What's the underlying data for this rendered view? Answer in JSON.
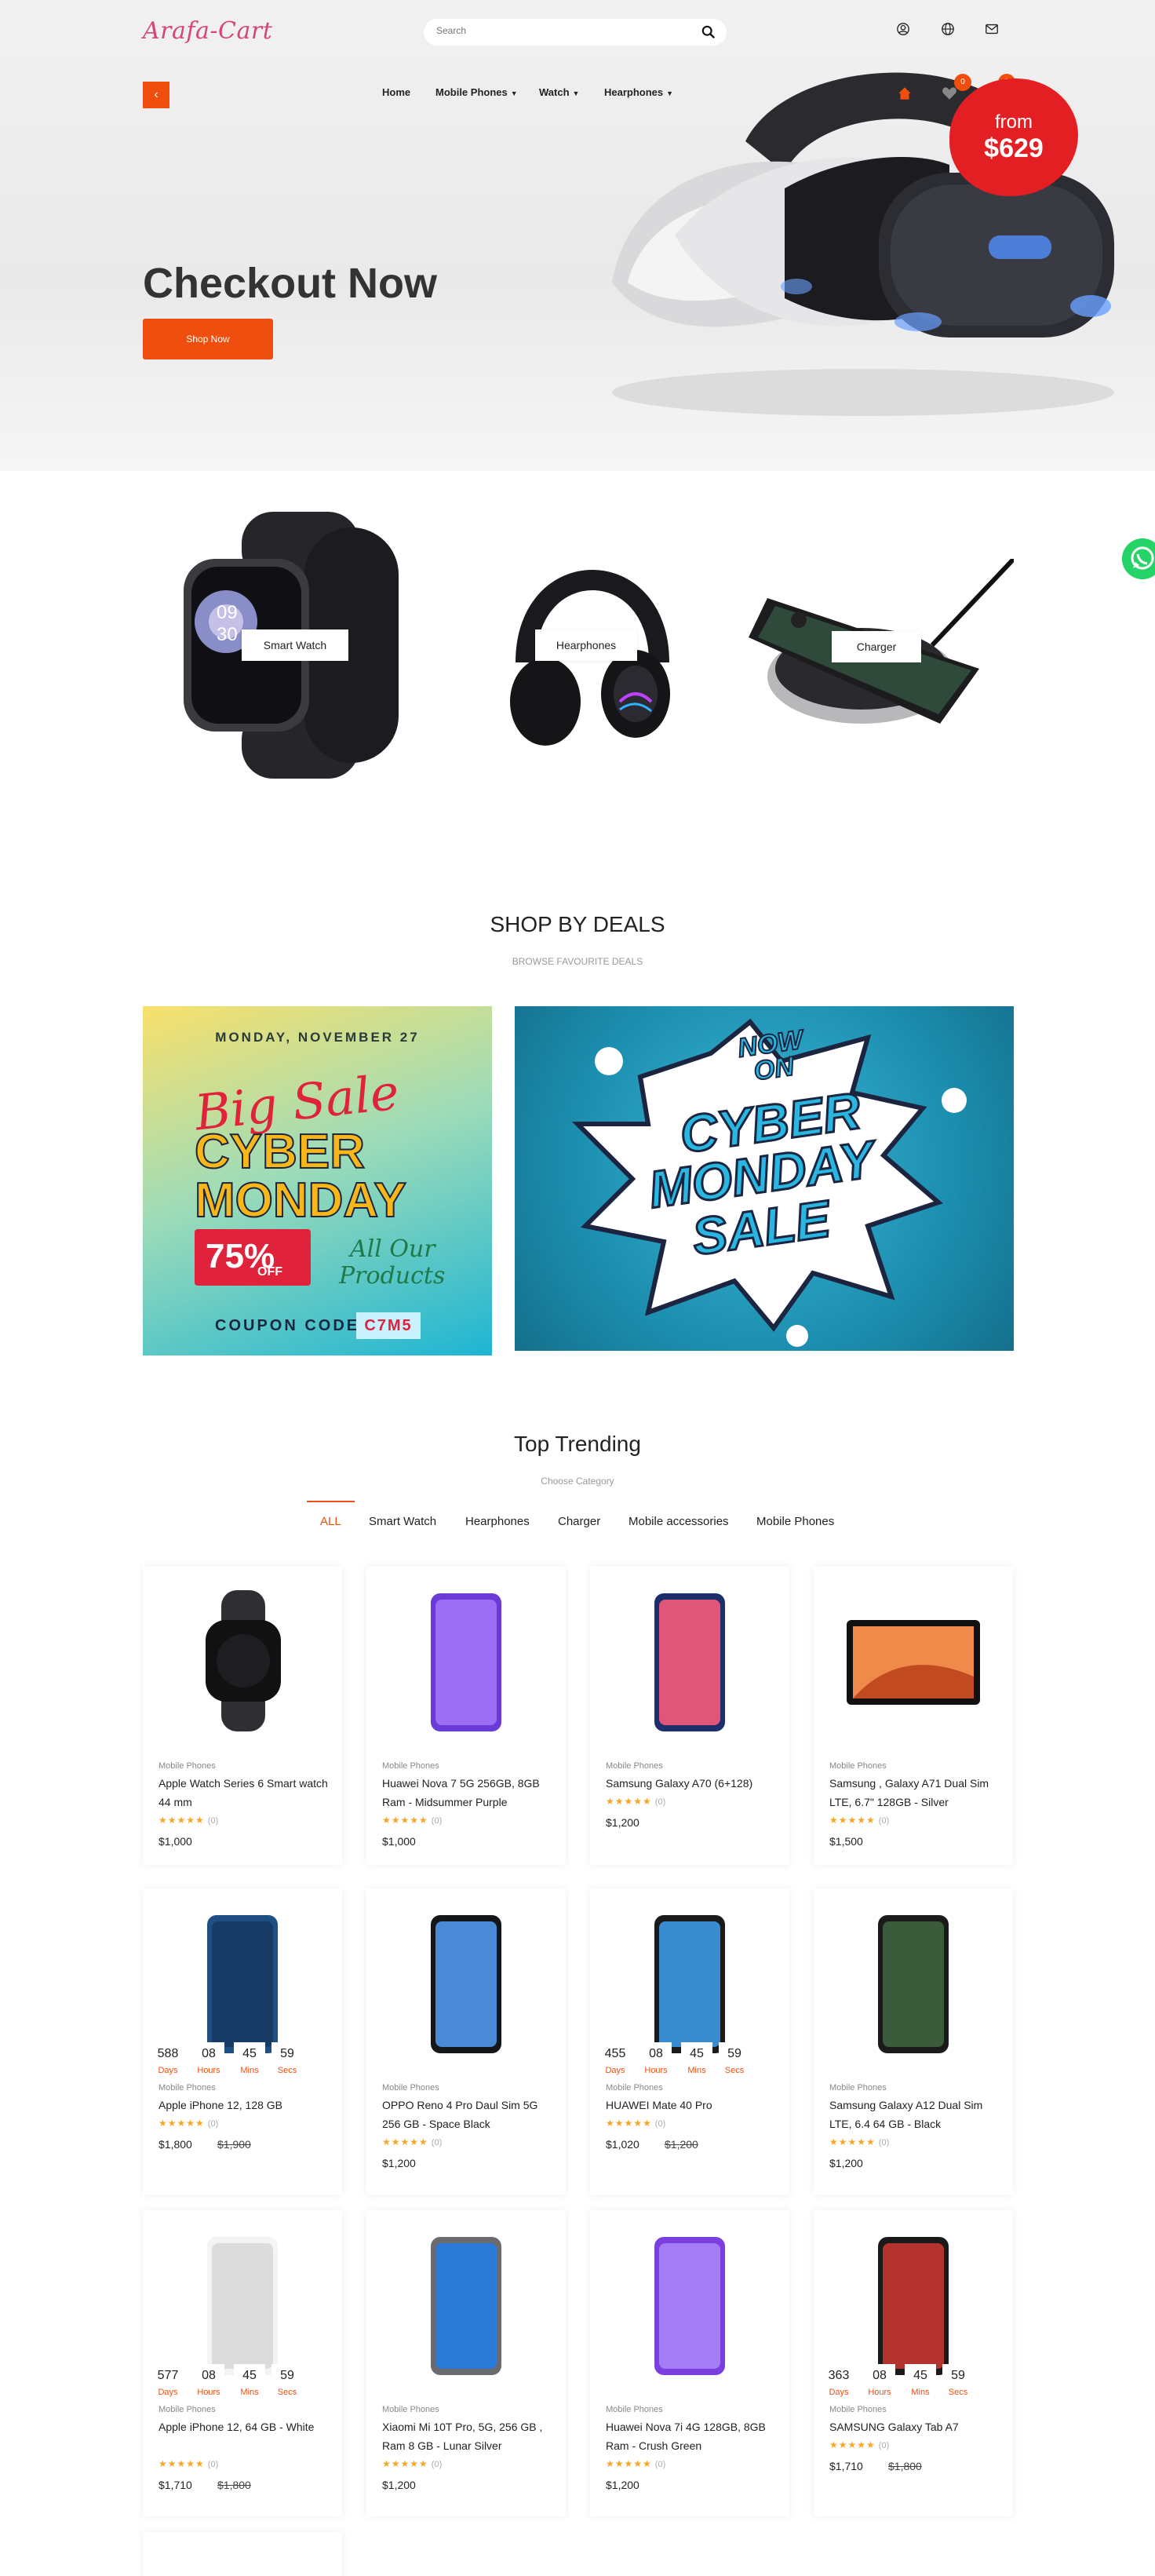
{
  "header": {
    "logo": "Arafa-Cart",
    "search_placeholder": "Search",
    "nav": [
      "Home",
      "Mobile Phones",
      "Watch",
      "Hearphones"
    ],
    "cart_count": "0",
    "wish_count": "0"
  },
  "hero": {
    "title": "Checkout Now",
    "button": "Shop Now",
    "price_from": "from",
    "price_value": "$629"
  },
  "categories": [
    "Smart Watch",
    "Hearphones",
    "Charger"
  ],
  "deals": {
    "title": "SHOP BY DEALS",
    "subtitle": "BROWSE FAVOURITE DEALS",
    "banner1": {
      "date": "MONDAY, NOVEMBER 27",
      "big_sale": "Big Sale",
      "cyber": "CYBER",
      "monday": "MONDAY",
      "percent": "75%",
      "off": "OFF",
      "all_our": "All Our",
      "products": "Products",
      "coupon_label": "COUPON CODE",
      "coupon_code": "C7M5"
    },
    "banner2": {
      "now_on": "NOW ON",
      "cyber": "CYBER",
      "monday": "MONDAY",
      "sale": "SALE"
    }
  },
  "trending": {
    "title": "Top Trending",
    "subtitle": "Choose Category",
    "tabs": [
      "ALL",
      "Smart Watch",
      "Hearphones",
      "Charger",
      "Mobile accessories",
      "Mobile Phones"
    ]
  },
  "products": [
    {
      "category": "Mobile Phones",
      "name": "Apple Watch Series 6 Smart watch 44 mm",
      "rating_count": "(0)",
      "price": "$1,000",
      "old_price": "",
      "countdown": null
    },
    {
      "category": "Mobile Phones",
      "name": "Huawei Nova 7 5G 256GB, 8GB Ram - Midsummer Purple",
      "rating_count": "(0)",
      "price": "$1,000",
      "old_price": "",
      "countdown": null
    },
    {
      "category": "Mobile Phones",
      "name": "Samsung Galaxy A70 (6+128)",
      "rating_count": "(0)",
      "price": "$1,200",
      "old_price": "",
      "countdown": null
    },
    {
      "category": "Mobile Phones",
      "name": "Samsung , Galaxy A71 Dual Sim LTE, 6.7\" 128GB - Silver",
      "rating_count": "(0)",
      "price": "$1,500",
      "old_price": "",
      "countdown": null
    },
    {
      "category": "Mobile Phones",
      "name": "Apple iPhone 12, 128 GB",
      "rating_count": "(0)",
      "price": "$1,800",
      "old_price": "$1,900",
      "countdown": {
        "days": "588",
        "hours": "08",
        "mins": "45",
        "secs": "59"
      }
    },
    {
      "category": "Mobile Phones",
      "name": "OPPO Reno 4 Pro Daul Sim 5G 256 GB - Space Black",
      "rating_count": "(0)",
      "price": "$1,200",
      "old_price": "",
      "countdown": null
    },
    {
      "category": "Mobile Phones",
      "name": "HUAWEI Mate 40 Pro",
      "rating_count": "(0)",
      "price": "$1,020",
      "old_price": "$1,200",
      "countdown": {
        "days": "455",
        "hours": "08",
        "mins": "45",
        "secs": "59"
      }
    },
    {
      "category": "Mobile Phones",
      "name": "Samsung Galaxy A12 Dual Sim LTE, 6.4 64 GB - Black",
      "rating_count": "(0)",
      "price": "$1,200",
      "old_price": "",
      "countdown": null
    },
    {
      "category": "Mobile Phones",
      "name": "Apple iPhone 12, 64 GB - White",
      "rating_count": "(0)",
      "price": "$1,710",
      "old_price": "$1,800",
      "countdown": {
        "days": "577",
        "hours": "08",
        "mins": "45",
        "secs": "59"
      }
    },
    {
      "category": "Mobile Phones",
      "name": "Xiaomi Mi 10T Pro, 5G, 256 GB , Ram 8 GB - Lunar Silver",
      "rating_count": "(0)",
      "price": "$1,200",
      "old_price": "",
      "countdown": null
    },
    {
      "category": "Mobile Phones",
      "name": "Huawei Nova 7i 4G 128GB, 8GB Ram - Crush Green",
      "rating_count": "(0)",
      "price": "$1,200",
      "old_price": "",
      "countdown": null
    },
    {
      "category": "Mobile Phones",
      "name": "SAMSUNG Galaxy Tab A7",
      "rating_count": "(0)",
      "price": "$1,710",
      "old_price": "$1,800",
      "countdown": {
        "days": "363",
        "hours": "08",
        "mins": "45",
        "secs": "59"
      }
    }
  ],
  "countdown_units": {
    "days": "Days",
    "hours": "Hours",
    "mins": "Mins",
    "secs": "Secs"
  },
  "colors": {
    "accent": "#f04e0f",
    "star": "#f5a623",
    "whatsapp": "#25d366",
    "price_blob": "#e41f23"
  }
}
